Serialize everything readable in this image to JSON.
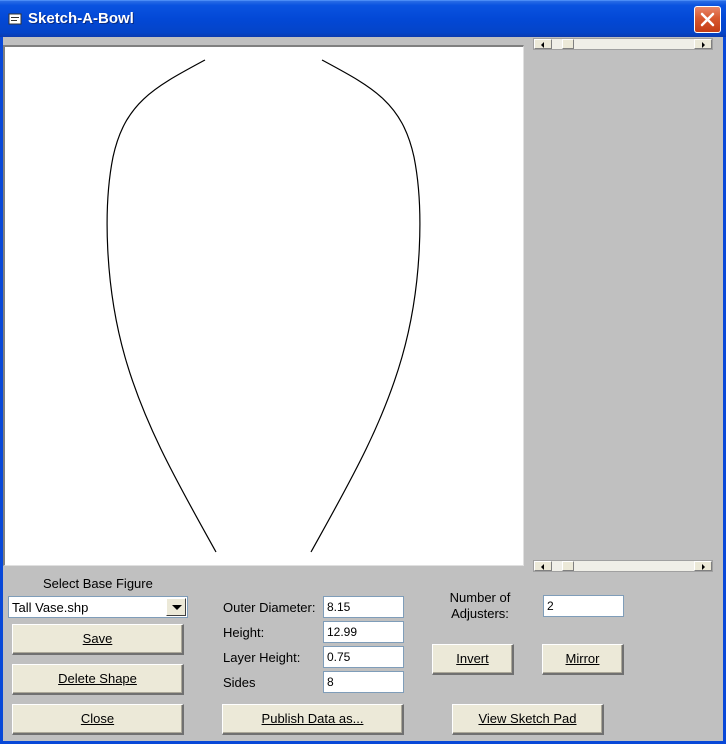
{
  "window": {
    "title": "Sketch-A-Bowl"
  },
  "icons": {
    "app": "app-icon",
    "close": "close-icon"
  },
  "base_figure": {
    "label": "Select Base Figure",
    "selected": "Tall Vase.shp"
  },
  "buttons": {
    "save": "Save",
    "delete_shape": "Delete Shape",
    "close": "Close",
    "publish": "Publish Data as...",
    "invert": "Invert",
    "mirror": "Mirror",
    "view_sketch_pad": "View Sketch Pad"
  },
  "fields": {
    "outer_diameter": {
      "label": "Outer Diameter:",
      "value": "8.15"
    },
    "height": {
      "label": "Height:",
      "value": "12.99"
    },
    "layer_height": {
      "label": "Layer Height:",
      "value": "0.75"
    },
    "sides": {
      "label": "Sides",
      "value": "8"
    }
  },
  "adjusters": {
    "label_line1": "Number of",
    "label_line2": "Adjusters:",
    "value": "2"
  },
  "colors": {
    "title_bar": "#0a53e0",
    "close_button": "#d8582f",
    "face": "#c0c0c0"
  }
}
